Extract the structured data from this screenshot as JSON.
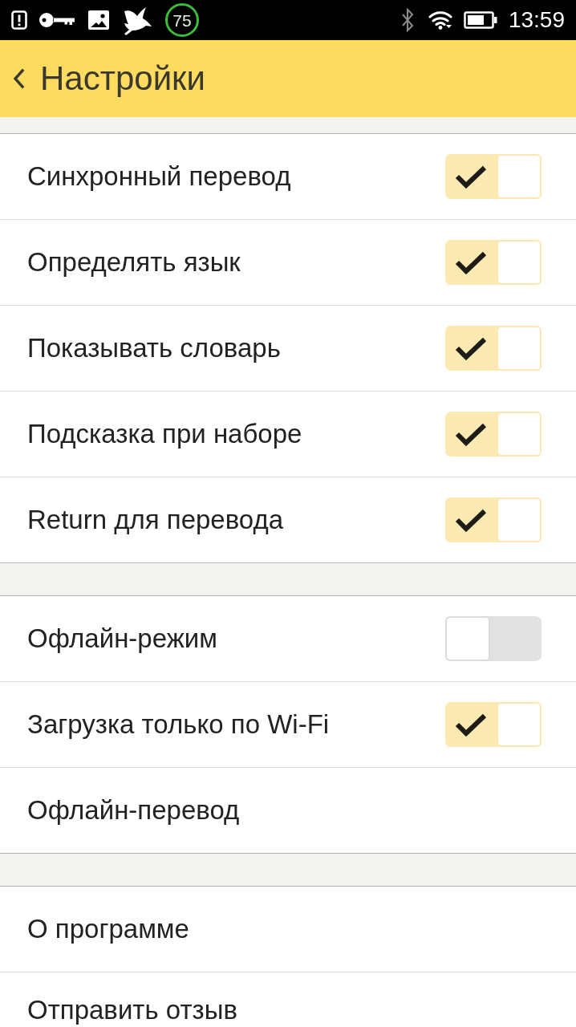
{
  "status_bar": {
    "badge": "75",
    "time": "13:59"
  },
  "header": {
    "title": "Настройки"
  },
  "sections": [
    {
      "items": [
        {
          "kind": "switch",
          "label": "Синхронный перевод",
          "on": true
        },
        {
          "kind": "switch",
          "label": "Определять язык",
          "on": true
        },
        {
          "kind": "switch",
          "label": "Показывать словарь",
          "on": true
        },
        {
          "kind": "switch",
          "label": "Подсказка при наборе",
          "on": true
        },
        {
          "kind": "switch",
          "label": "Return для перевода",
          "on": true
        }
      ]
    },
    {
      "items": [
        {
          "kind": "switch",
          "label": "Офлайн-режим",
          "on": false
        },
        {
          "kind": "switch",
          "label": "Загрузка только по Wi-Fi",
          "on": true
        },
        {
          "kind": "link",
          "label": "Офлайн-перевод"
        }
      ]
    },
    {
      "items": [
        {
          "kind": "link",
          "label": "О программе"
        },
        {
          "kind": "link",
          "label": "Отправить отзыв"
        }
      ]
    }
  ]
}
